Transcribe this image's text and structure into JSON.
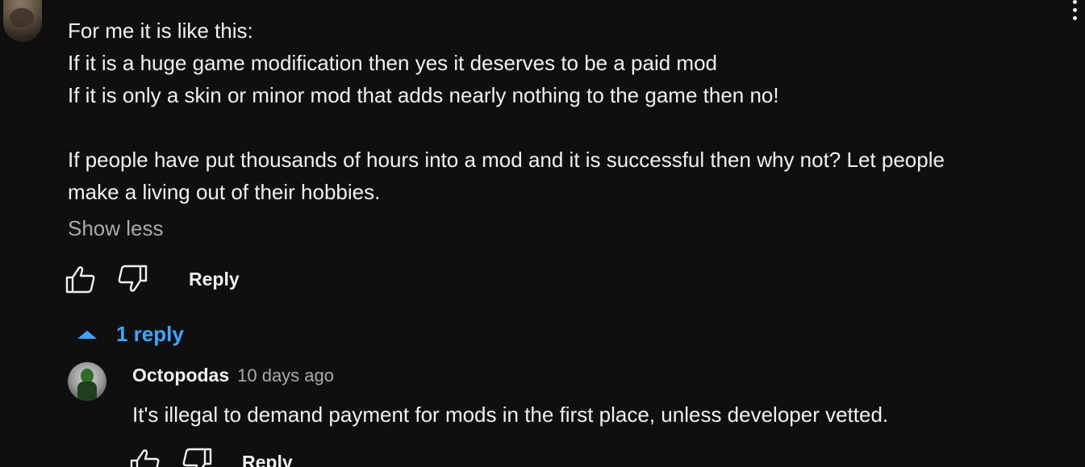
{
  "comment": {
    "lines": [
      "For me it is like this:",
      "If it is a huge game modification then yes it deserves to be a paid mod",
      "If it is only a skin or minor mod that adds nearly nothing to the game then no!",
      "",
      "If people have put thousands of hours into a mod and it is successful then why not? Let people",
      "make a living out of their hobbies."
    ],
    "show_less_label": "Show less",
    "reply_label": "Reply"
  },
  "replies_toggle": {
    "label": "1 reply"
  },
  "reply": {
    "author": "Octopodas",
    "time": "10 days ago",
    "text": "It's illegal to demand payment for mods in the first place, unless developer vetted.",
    "reply_label": "Reply"
  },
  "icons": {
    "like": "thumbs-up-icon",
    "dislike": "thumbs-down-icon",
    "menu": "more-vert-icon",
    "toggle": "caret-up-icon"
  },
  "colors": {
    "background": "#0f0f0f",
    "text": "#f1f1f1",
    "secondary_text": "#aaaaaa",
    "link_blue": "#3ea6ff"
  }
}
